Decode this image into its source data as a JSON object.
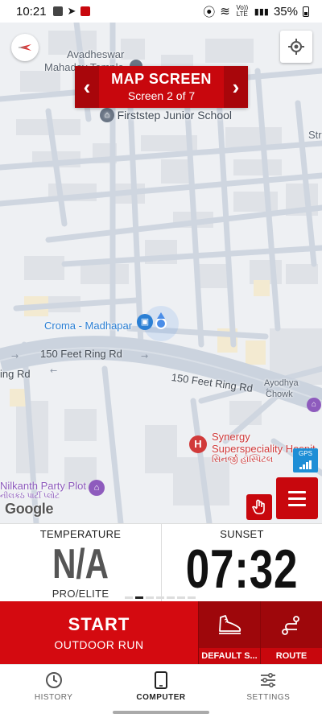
{
  "status_bar": {
    "time": "10:21",
    "battery": "35%",
    "net_label": "Vo)) LTE",
    "notif_colors": [
      "#444444",
      "#c8070d"
    ]
  },
  "map": {
    "labels": {
      "avadheswar": "Avadheswar",
      "mahadev": "Mahadev Temple",
      "school": "Firststep Junior School",
      "str": "Str",
      "croma": "Croma - Madhapar",
      "ring_rd_1": "150 Feet Ring Rd",
      "ring_rd_2": "150 Feet Ring Rd",
      "ring_rd_left": "ing Rd",
      "ayodhya": "Ayodhya",
      "chowk": "Chowk",
      "synergy_1": "Synergy",
      "synergy_2": "Superspeciality Hospita",
      "synergy_guj": "સિનર્જી હૉસ્પિટલ",
      "nilkanth": "Nilkanth Party Plot",
      "nilkanth_guj": "નીલકંઠ પાર્ટી પ્લોટ",
      "google": "Google"
    },
    "banner": {
      "title": "MAP SCREEN",
      "subtitle": "Screen 2 of 7",
      "prev": "‹",
      "next": "›"
    },
    "gps": "GPS",
    "icons": [
      "compass-icon",
      "locate-icon",
      "hand-icon",
      "menu-icon"
    ]
  },
  "panels": {
    "temperature": {
      "label": "TEMPERATURE",
      "value": "N/A",
      "sub": "PRO/ELITE"
    },
    "sunset": {
      "label": "SUNSET",
      "value": "07:32"
    },
    "page_count": 7,
    "page_active": 1
  },
  "actions": {
    "start": {
      "title": "START",
      "subtitle": "OUTDOOR RUN"
    },
    "default_s": "DEFAULT S...",
    "route": "ROUTE"
  },
  "bottom_nav": [
    {
      "label": "HISTORY",
      "icon": "clock-icon"
    },
    {
      "label": "COMPUTER",
      "icon": "phone-icon",
      "active": true
    },
    {
      "label": "SETTINGS",
      "icon": "sliders-icon"
    }
  ],
  "colors": {
    "brand_red": "#c8070d",
    "gps_blue": "#1e8ed6"
  }
}
